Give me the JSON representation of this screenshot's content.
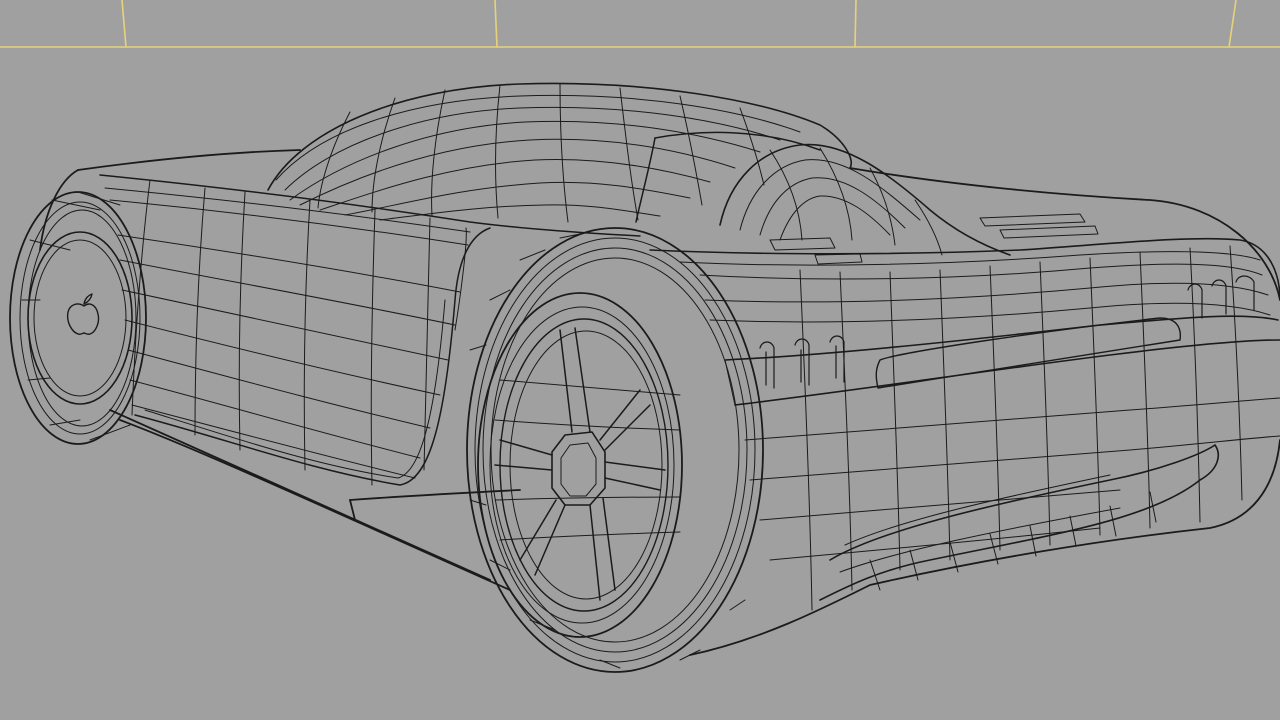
{
  "viewport": {
    "background": "#a0a0a0",
    "wire_color": "#1b1b1b",
    "grid_color": "#e6d27a",
    "subject": "car-wireframe-model"
  },
  "emblem": {
    "icon": "apple-logo-icon"
  }
}
